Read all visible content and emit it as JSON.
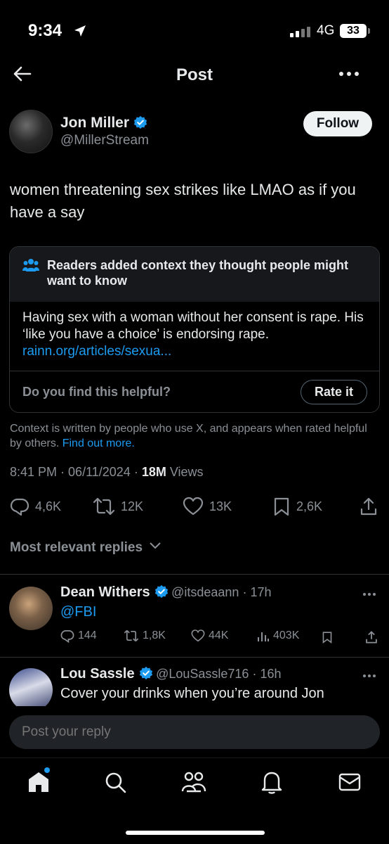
{
  "status_bar": {
    "time": "9:34",
    "network": "4G",
    "battery": "33"
  },
  "header": {
    "title": "Post"
  },
  "post": {
    "author_name": "Jon Miller",
    "author_handle": "@MillerStream",
    "follow_label": "Follow",
    "text": "women threatening sex strikes like LMAO as if you have a say",
    "note": {
      "title": "Readers added context they thought people might want to know",
      "body": "Having sex with a woman without her consent is rape. His ‘like you have a choice’ is endorsing rape.",
      "link": "rainn.org/articles/sexua...",
      "question": "Do you find this helpful?",
      "rate_label": "Rate it"
    },
    "context_info": "Context is written by people who use X, and appears when rated helpful by others.",
    "context_link": "Find out more.",
    "time": "8:41 PM",
    "date": "06/11/2024",
    "views_count": "18M",
    "views_label": "Views",
    "stats": {
      "replies": "4,6K",
      "reposts": "12K",
      "likes": "13K",
      "bookmarks": "2,6K"
    }
  },
  "replies_filter": "Most relevant replies",
  "replies": [
    {
      "name": "Dean Withers",
      "handle": "@itsdeaann",
      "age": "17h",
      "text": "@FBI",
      "stats": {
        "replies": "144",
        "reposts": "1,8K",
        "likes": "44K",
        "views": "403K"
      }
    },
    {
      "name": "Lou Sassle",
      "handle": "@LouSassle716",
      "age": "16h",
      "text": "Cover your drinks when you’re around Jon"
    }
  ],
  "composer": {
    "placeholder": "Post your reply"
  },
  "colors": {
    "accent": "#1d9bf0",
    "background": "#000000",
    "muted": "#8b9096"
  },
  "nav_icons": [
    "home-icon",
    "search-icon",
    "communities-icon",
    "notifications-icon",
    "messages-icon"
  ]
}
